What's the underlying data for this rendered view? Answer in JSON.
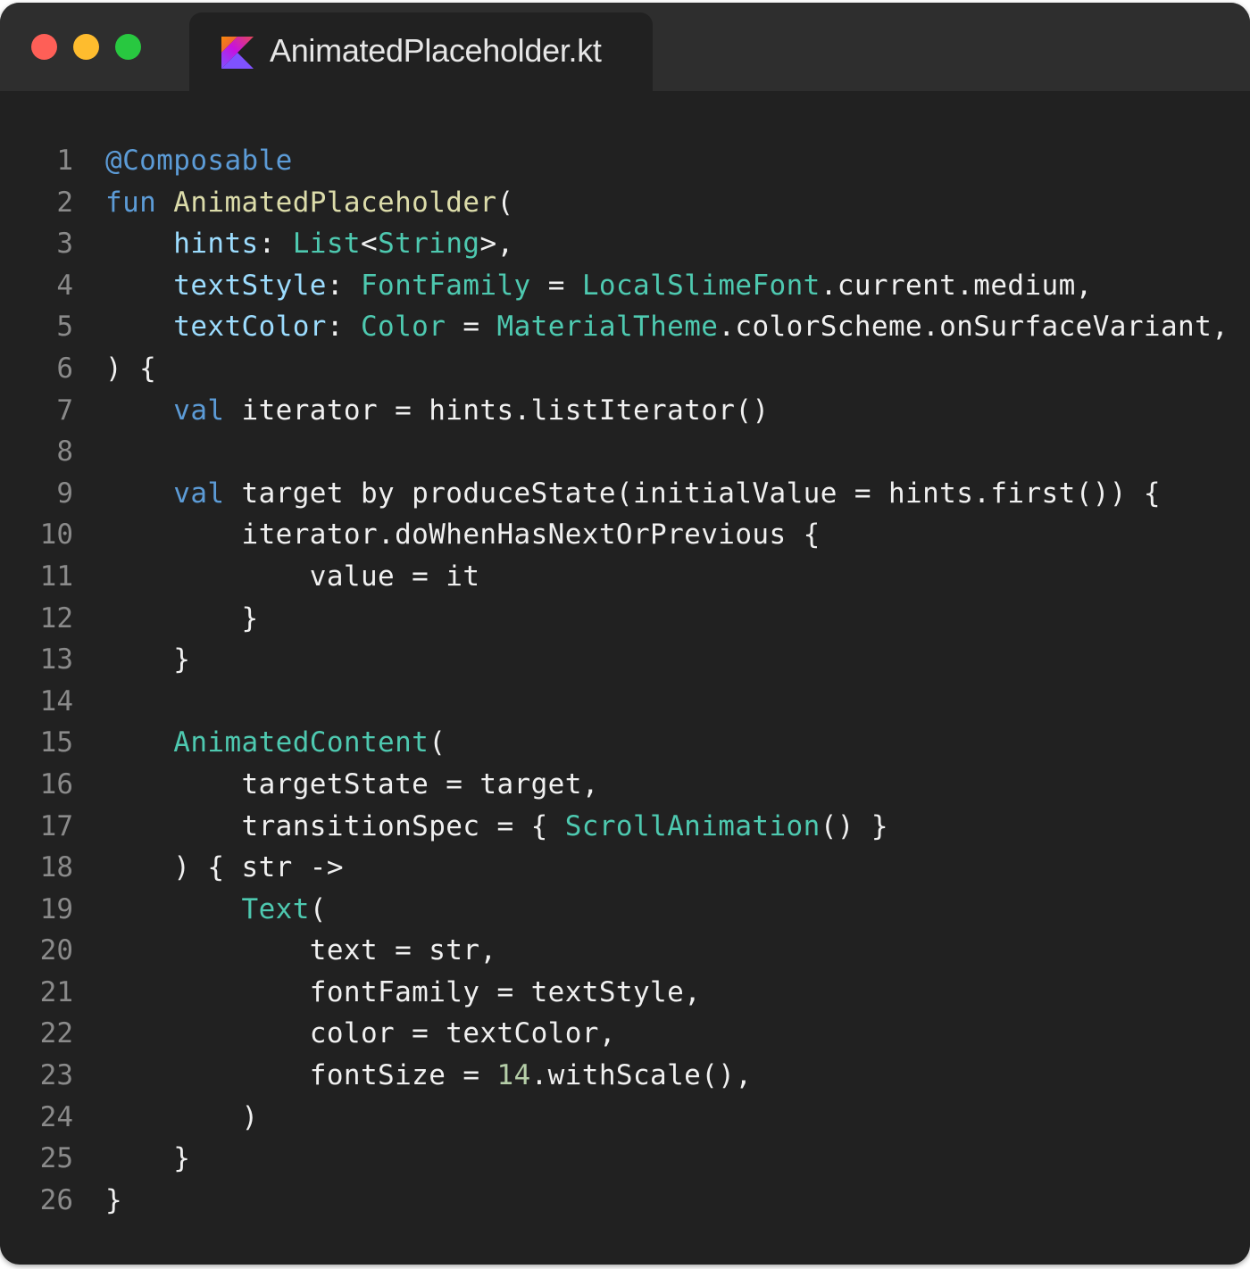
{
  "window": {
    "traffic_lights": {
      "close": "#fe5f57",
      "minimize": "#febc2e",
      "zoom": "#28c840"
    },
    "tab": {
      "icon": "kotlin-logo-icon",
      "title": "AnimatedPlaceholder.kt"
    },
    "colors": {
      "background": "#212121",
      "titlebar": "#2e2e2e",
      "line_number": "#8a8a8a",
      "default": "#f0f0f0",
      "annotation": "#5c9bd6",
      "keyword": "#5c9bd6",
      "function_name": "#dcdcaa",
      "parameter": "#9cdcfe",
      "type": "#4ec9b0",
      "number": "#b5cea8"
    }
  },
  "code": {
    "language": "kotlin",
    "lines": [
      {
        "n": "1",
        "tokens": [
          {
            "t": "@Composable",
            "k": "annotation"
          }
        ]
      },
      {
        "n": "2",
        "tokens": [
          {
            "t": "fun",
            "k": "keyword"
          },
          {
            "t": " "
          },
          {
            "t": "AnimatedPlaceholder",
            "k": "function_name"
          },
          {
            "t": "("
          }
        ]
      },
      {
        "n": "3",
        "tokens": [
          {
            "t": "    "
          },
          {
            "t": "hints",
            "k": "parameter"
          },
          {
            "t": ": "
          },
          {
            "t": "List",
            "k": "type"
          },
          {
            "t": "<"
          },
          {
            "t": "String",
            "k": "type"
          },
          {
            "t": ">,"
          }
        ]
      },
      {
        "n": "4",
        "tokens": [
          {
            "t": "    "
          },
          {
            "t": "textStyle",
            "k": "parameter"
          },
          {
            "t": ": "
          },
          {
            "t": "FontFamily",
            "k": "type"
          },
          {
            "t": " = "
          },
          {
            "t": "LocalSlimeFont",
            "k": "type"
          },
          {
            "t": ".current.medium,"
          }
        ]
      },
      {
        "n": "5",
        "tokens": [
          {
            "t": "    "
          },
          {
            "t": "textColor",
            "k": "parameter"
          },
          {
            "t": ": "
          },
          {
            "t": "Color",
            "k": "type"
          },
          {
            "t": " = "
          },
          {
            "t": "MaterialTheme",
            "k": "type"
          },
          {
            "t": ".colorScheme.onSurfaceVariant,"
          }
        ]
      },
      {
        "n": "6",
        "tokens": [
          {
            "t": ") {"
          }
        ]
      },
      {
        "n": "7",
        "tokens": [
          {
            "t": "    "
          },
          {
            "t": "val",
            "k": "keyword"
          },
          {
            "t": " iterator = hints.listIterator()"
          }
        ]
      },
      {
        "n": "8",
        "tokens": []
      },
      {
        "n": "9",
        "tokens": [
          {
            "t": "    "
          },
          {
            "t": "val",
            "k": "keyword"
          },
          {
            "t": " target by produceState(initialValue = hints.first()) {"
          }
        ]
      },
      {
        "n": "10",
        "tokens": [
          {
            "t": "        iterator.doWhenHasNextOrPrevious {"
          }
        ]
      },
      {
        "n": "11",
        "tokens": [
          {
            "t": "            value = it"
          }
        ]
      },
      {
        "n": "12",
        "tokens": [
          {
            "t": "        }"
          }
        ]
      },
      {
        "n": "13",
        "tokens": [
          {
            "t": "    }"
          }
        ]
      },
      {
        "n": "14",
        "tokens": []
      },
      {
        "n": "15",
        "tokens": [
          {
            "t": "    "
          },
          {
            "t": "AnimatedContent",
            "k": "type"
          },
          {
            "t": "("
          }
        ]
      },
      {
        "n": "16",
        "tokens": [
          {
            "t": "        targetState = target,"
          }
        ]
      },
      {
        "n": "17",
        "tokens": [
          {
            "t": "        transitionSpec = { "
          },
          {
            "t": "ScrollAnimation",
            "k": "type"
          },
          {
            "t": "() }"
          }
        ]
      },
      {
        "n": "18",
        "tokens": [
          {
            "t": "    ) { str ->"
          }
        ]
      },
      {
        "n": "19",
        "tokens": [
          {
            "t": "        "
          },
          {
            "t": "Text",
            "k": "type"
          },
          {
            "t": "("
          }
        ]
      },
      {
        "n": "20",
        "tokens": [
          {
            "t": "            text = str,"
          }
        ]
      },
      {
        "n": "21",
        "tokens": [
          {
            "t": "            fontFamily = textStyle,"
          }
        ]
      },
      {
        "n": "22",
        "tokens": [
          {
            "t": "            color = textColor,"
          }
        ]
      },
      {
        "n": "23",
        "tokens": [
          {
            "t": "            fontSize = "
          },
          {
            "t": "14",
            "k": "number"
          },
          {
            "t": ".withScale(),"
          }
        ]
      },
      {
        "n": "24",
        "tokens": [
          {
            "t": "        )"
          }
        ]
      },
      {
        "n": "25",
        "tokens": [
          {
            "t": "    }"
          }
        ]
      },
      {
        "n": "26",
        "tokens": [
          {
            "t": "}"
          }
        ]
      }
    ]
  }
}
